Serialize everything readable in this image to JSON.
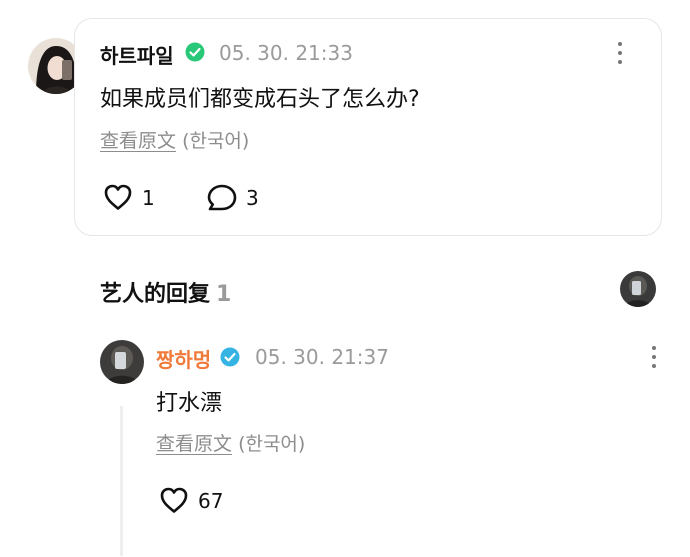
{
  "comment": {
    "author": "하트파일",
    "time": "05. 30. 21:33",
    "text": "如果成员们都变成石头了怎么办?",
    "translate_link": "查看原文",
    "translate_lang": "(한국어)",
    "like_count": "1",
    "reply_count": "3"
  },
  "artist_replies": {
    "title": "艺人的回复",
    "count": "1"
  },
  "reply": {
    "author": "짱하멍",
    "time": "05. 30. 21:37",
    "text": "打水漂",
    "translate_link": "查看原文",
    "translate_lang": "(한국어)",
    "like_count": "67"
  },
  "colors": {
    "verified_comment": "#29c878",
    "verified_artist": "#35b4e4",
    "artist_name": "#f07a3a"
  }
}
